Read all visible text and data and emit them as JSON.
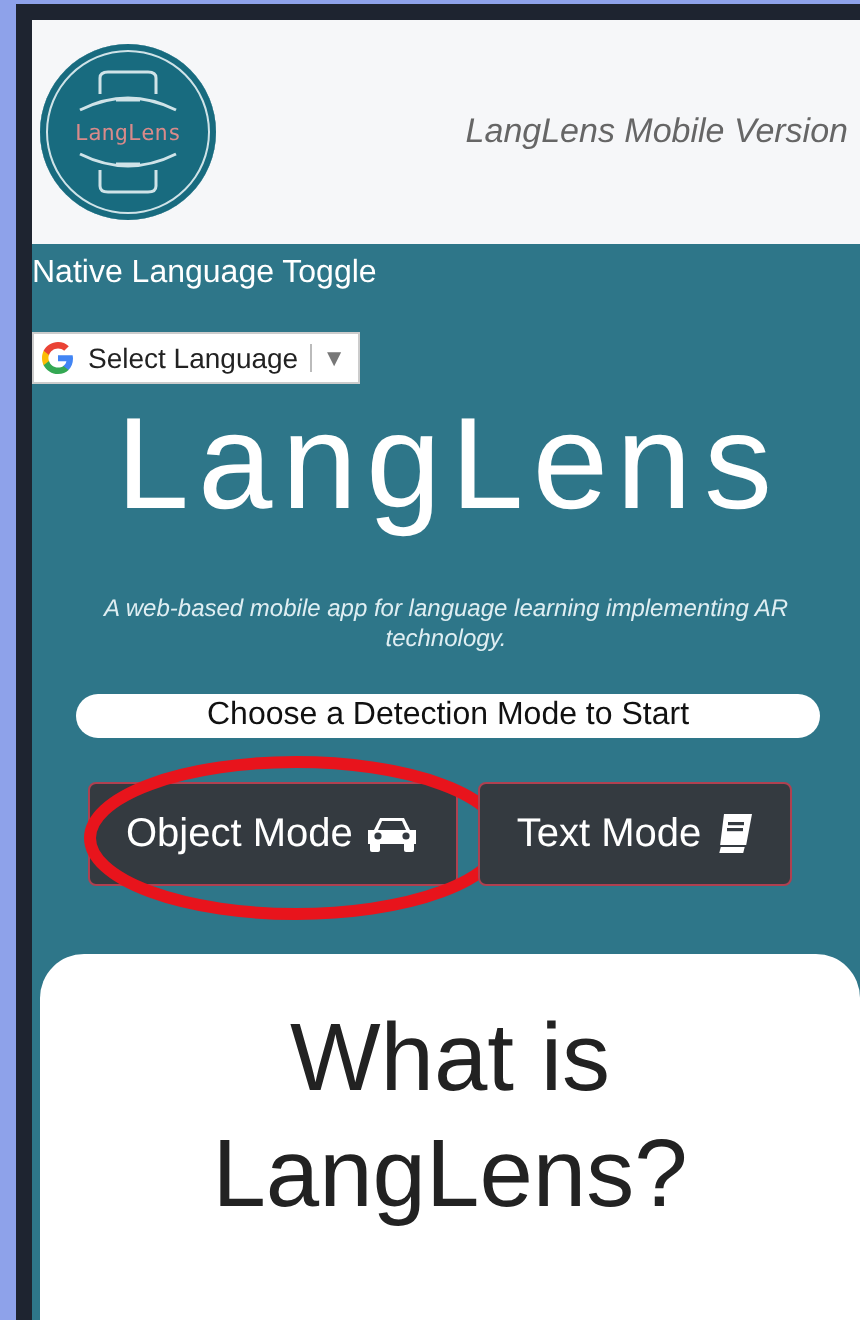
{
  "header": {
    "logo_text": "LangLens",
    "tagline": "LangLens Mobile Version"
  },
  "toggle_label": "Native Language Toggle",
  "language_select": {
    "label": "Select Language",
    "arrow": "▼"
  },
  "hero": {
    "title": "LangLens",
    "subtitle": "A web-based mobile app for language learning implementing AR technology."
  },
  "prompt": "Choose a Detection Mode to Start",
  "modes": [
    {
      "label": "Object Mode",
      "kind": "car",
      "highlighted": true
    },
    {
      "label": "Text Mode",
      "kind": "book",
      "highlighted": false
    }
  ],
  "card": {
    "heading": "What is LangLens?"
  }
}
